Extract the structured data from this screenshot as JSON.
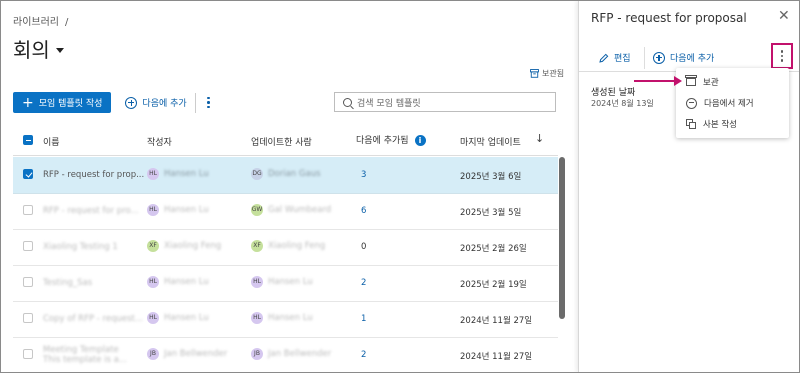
{
  "breadcrumb": {
    "root": "라이브러리",
    "separator": "/"
  },
  "page": {
    "title": "회의"
  },
  "archive_link": "보관됨",
  "toolbar": {
    "create_button": "모임 템플릿 작성",
    "add_next_button": "다음에 추가",
    "search_placeholder": "검색 모임 템플릿"
  },
  "table": {
    "columns": {
      "name": "이름",
      "author": "작성자",
      "updated_by": "업데이트한 사람",
      "added_to_next": "다음에 추가됨",
      "last_updated": "마지막 업데이트"
    },
    "rows": [
      {
        "name": "RFP - request for prop...",
        "author_initials": "HL",
        "author_name": "Hansen Lu",
        "updater_initials": "DG",
        "updater_name": "Dorian Gaus",
        "count": "3",
        "count_link": true,
        "date": "2025년 3월 6일",
        "selected": true
      },
      {
        "name": "RFP - request for pro...",
        "author_initials": "HL",
        "author_name": "Hansen Lu",
        "updater_initials": "GW",
        "updater_name": "Gal Wumbeard",
        "count": "6",
        "count_link": true,
        "date": "2025년 3월 5일",
        "selected": false
      },
      {
        "name": "Xiaoling Testing 1",
        "author_initials": "XF",
        "author_name": "Xiaoling Feng",
        "updater_initials": "XF",
        "updater_name": "Xiaoling Feng",
        "count": "0",
        "count_link": false,
        "date": "2025년 2월 26일",
        "selected": false
      },
      {
        "name": "Testing_Sas",
        "author_initials": "HL",
        "author_name": "Hansen Lu",
        "updater_initials": "HL",
        "updater_name": "Hansen Lu",
        "count": "2",
        "count_link": true,
        "date": "2025년 2월 19일",
        "selected": false
      },
      {
        "name": "Copy of RFP - request...",
        "author_initials": "HL",
        "author_name": "Hansen Lu",
        "updater_initials": "HL",
        "updater_name": "Hansen Lu",
        "count": "1",
        "count_link": true,
        "date": "2024년 11월 27일",
        "selected": false
      },
      {
        "name": "Meeting Template",
        "name_line2": "This template is a...",
        "author_initials": "JB",
        "author_name": "Jan Bellwender",
        "updater_initials": "JB",
        "updater_name": "Jan Bellwender",
        "count": "2",
        "count_link": true,
        "date": "2024년 11월 27일",
        "selected": false
      }
    ]
  },
  "panel": {
    "title": "RFP - request for proposal",
    "edit_button": "편집",
    "add_next_button": "다음에 추가",
    "created_label": "생성된 날짜",
    "created_date": "2024년 8월 13일",
    "menu": {
      "archive": "보관",
      "remove_next": "다음에서 제거",
      "copy": "사본 작성"
    }
  },
  "colors": {
    "primary": "#0a72c4",
    "highlight": "#c2116c",
    "selected_row": "#d6edf7"
  }
}
